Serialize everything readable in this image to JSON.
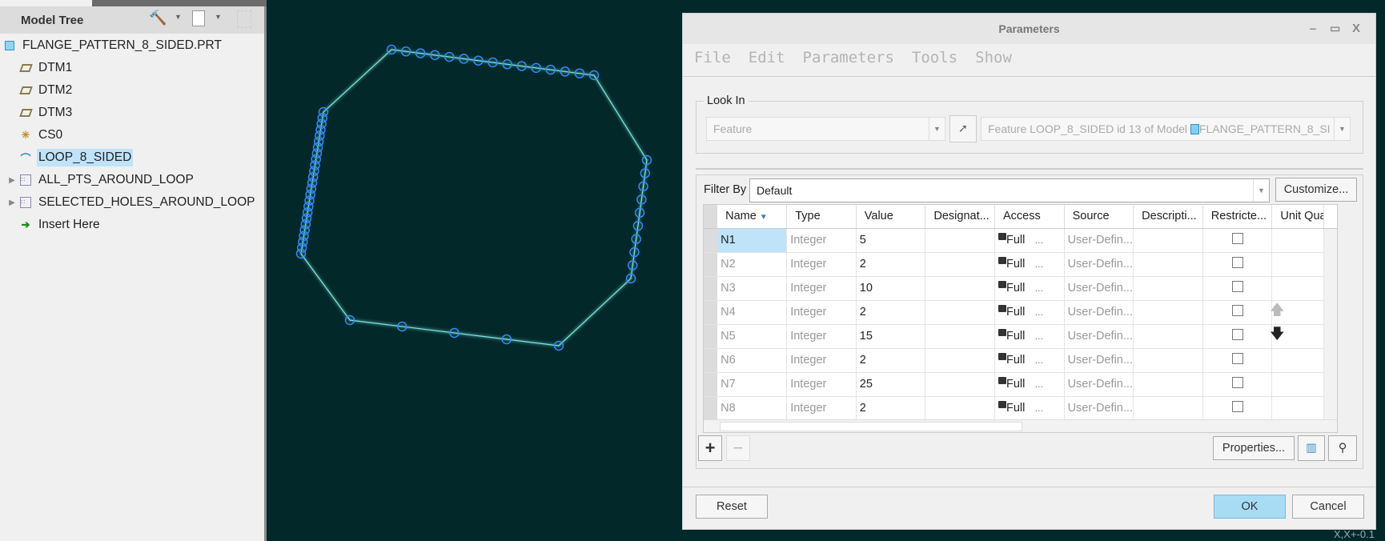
{
  "model_tree": {
    "title": "Model Tree",
    "items": [
      {
        "label": "FLANGE_PATTERN_8_SIDED.PRT",
        "icon": "part-icon"
      },
      {
        "label": "DTM1",
        "icon": "datum-plane-icon"
      },
      {
        "label": "DTM2",
        "icon": "datum-plane-icon"
      },
      {
        "label": "DTM3",
        "icon": "datum-plane-icon"
      },
      {
        "label": "CS0",
        "icon": "coordinate-system-icon"
      },
      {
        "label": "LOOP_8_SIDED",
        "icon": "curve-icon",
        "selected": true
      },
      {
        "label": "ALL_PTS_AROUND_LOOP",
        "icon": "pattern-icon",
        "expandable": true
      },
      {
        "label": "SELECTED_HOLES_AROUND_LOOP",
        "icon": "pattern-icon",
        "expandable": true
      },
      {
        "label": "Insert Here",
        "icon": "insert-arrow-icon"
      }
    ]
  },
  "viewport": {
    "line_color": "#7fe6e0",
    "point_color": "#2f8cff",
    "background": "#03282a",
    "status_text": "X,X+-0.1"
  },
  "dialog": {
    "title": "Parameters",
    "menu": [
      "File",
      "Edit",
      "Parameters",
      "Tools",
      "Show"
    ],
    "look_in": {
      "label": "Look In",
      "type_value": "Feature",
      "object_text": "Feature LOOP_8_SIDED id 13 of Model",
      "model_name": "FLANGE_PATTERN_8_SI"
    },
    "filter": {
      "label": "Filter By",
      "value": "Default",
      "customize": "Customize..."
    },
    "columns": [
      "Name",
      "Type",
      "Value",
      "Designat...",
      "Access",
      "Source",
      "Descripti...",
      "Restricte...",
      "Unit Qua..."
    ],
    "rows": [
      {
        "name": "N1",
        "type": "Integer",
        "value": "5",
        "access": "Full",
        "source": "User-Defin..."
      },
      {
        "name": "N2",
        "type": "Integer",
        "value": "2",
        "access": "Full",
        "source": "User-Defin..."
      },
      {
        "name": "N3",
        "type": "Integer",
        "value": "10",
        "access": "Full",
        "source": "User-Defin..."
      },
      {
        "name": "N4",
        "type": "Integer",
        "value": "2",
        "access": "Full",
        "source": "User-Defin..."
      },
      {
        "name": "N5",
        "type": "Integer",
        "value": "15",
        "access": "Full",
        "source": "User-Defin..."
      },
      {
        "name": "N6",
        "type": "Integer",
        "value": "2",
        "access": "Full",
        "source": "User-Defin..."
      },
      {
        "name": "N7",
        "type": "Integer",
        "value": "25",
        "access": "Full",
        "source": "User-Defin..."
      },
      {
        "name": "N8",
        "type": "Integer",
        "value": "2",
        "access": "Full",
        "source": "User-Defin..."
      }
    ],
    "properties": "Properties...",
    "reset": "Reset",
    "ok": "OK",
    "cancel": "Cancel",
    "ok_color": "#a8dcf5"
  }
}
